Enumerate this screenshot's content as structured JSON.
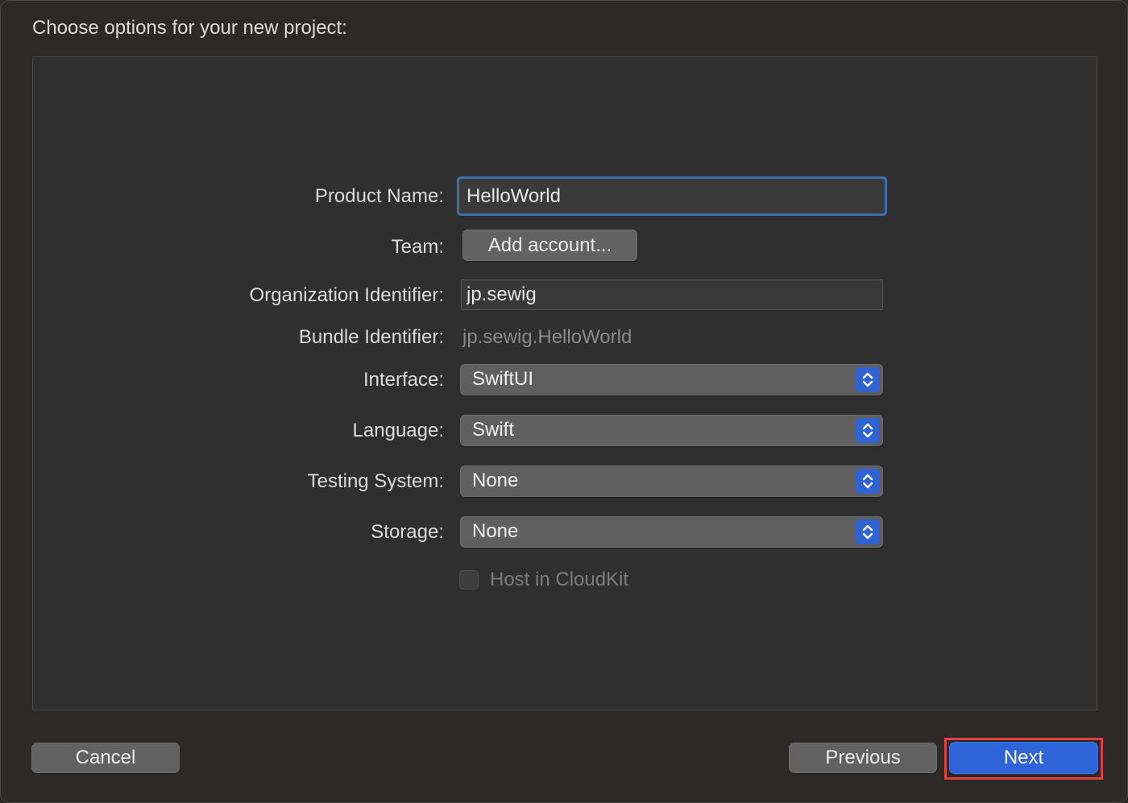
{
  "dialog": {
    "heading": "Choose options for your new project:"
  },
  "form": {
    "product_name": {
      "label": "Product Name:",
      "value": "HelloWorld"
    },
    "team": {
      "label": "Team:",
      "button_label": "Add account..."
    },
    "organization_identifier": {
      "label": "Organization Identifier:",
      "value": "jp.sewig"
    },
    "bundle_identifier": {
      "label": "Bundle Identifier:",
      "value": "jp.sewig.HelloWorld"
    },
    "interface": {
      "label": "Interface:",
      "selected": "SwiftUI"
    },
    "language": {
      "label": "Language:",
      "selected": "Swift"
    },
    "testing_system": {
      "label": "Testing System:",
      "selected": "None"
    },
    "storage": {
      "label": "Storage:",
      "selected": "None"
    },
    "host_in_cloudkit": {
      "label": "Host in CloudKit",
      "checked": false,
      "enabled": false
    }
  },
  "footer": {
    "cancel_label": "Cancel",
    "previous_label": "Previous",
    "next_label": "Next"
  },
  "colors": {
    "accent": "#2f64d8",
    "focus_ring": "#3d6fa8",
    "highlight": "#e0403f"
  },
  "icons": {
    "stepper": "chevron-up-down-icon"
  }
}
